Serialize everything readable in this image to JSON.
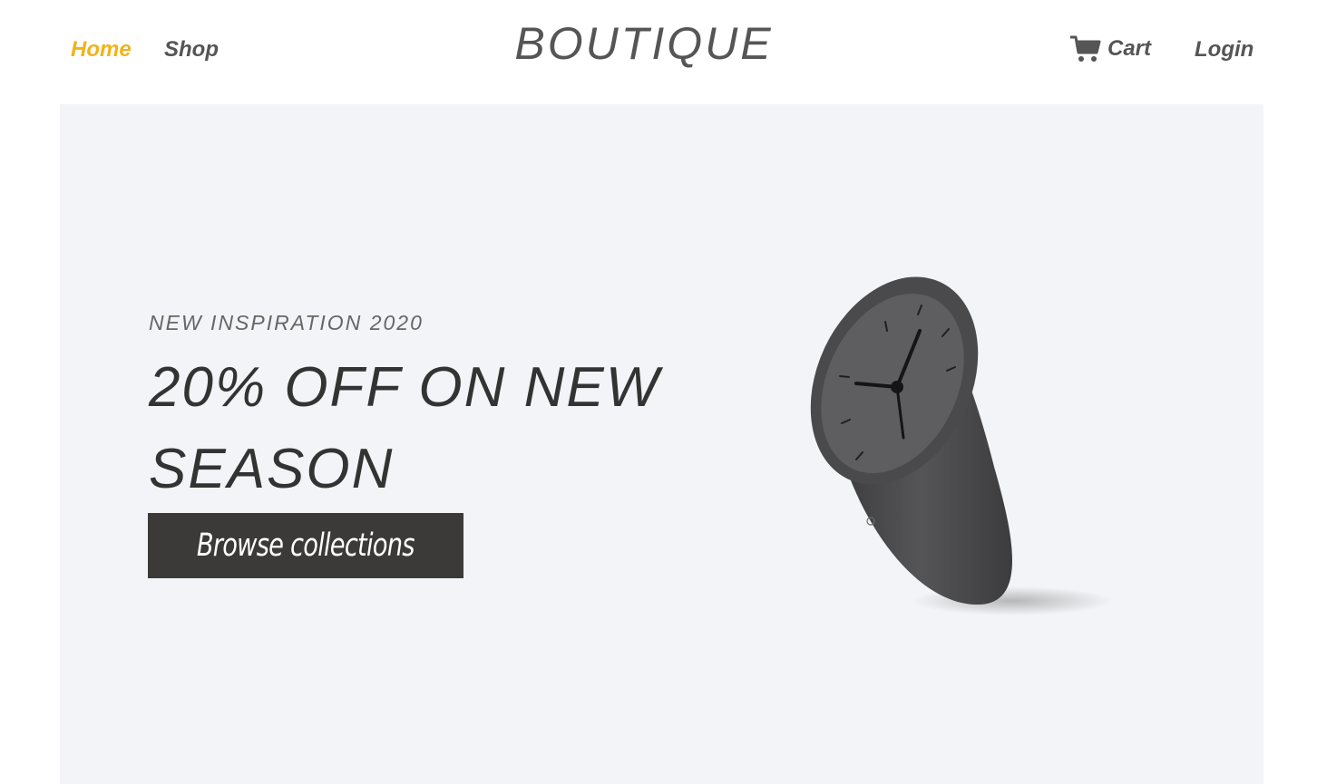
{
  "header": {
    "nav": {
      "home": "Home",
      "shop": "Shop"
    },
    "brand": "BOUTIQUE",
    "cart_label": "Cart",
    "login_label": "Login",
    "cart_icon": "cart-icon"
  },
  "hero": {
    "eyebrow": "NEW INSPIRATION 2020",
    "headline": "20% OFF ON NEW SEASON",
    "cta_label": "Browse collections",
    "image": "clock-image"
  },
  "colors": {
    "accent": "#f0b31a",
    "nav_text": "#555555",
    "hero_bg": "#f3f4f7",
    "cta_bg": "#3c3a38"
  }
}
